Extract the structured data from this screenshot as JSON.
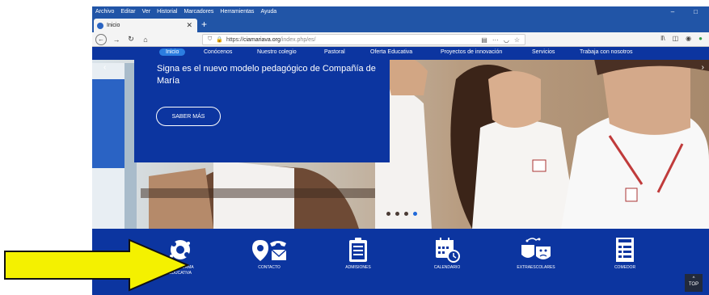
{
  "browser": {
    "menu": [
      "Archivo",
      "Editar",
      "Ver",
      "Historial",
      "Marcadores",
      "Herramientas",
      "Ayuda"
    ],
    "tab_title": "Inicio",
    "url_prefix": "https://",
    "url_host": "ciamariava.org",
    "url_path": "/index.php/es/",
    "window_controls": {
      "minimize": "–",
      "maximize": "□"
    }
  },
  "nav": {
    "items": [
      "Inicio",
      "Conócenos",
      "Nuestro colegio",
      "Pastoral",
      "Oferta Educativa",
      "Proyectos de innovación",
      "Servicios",
      "Trabaja con nosotros"
    ],
    "active": "Inicio"
  },
  "hero": {
    "headline": "Signa es el nuevo modelo pedagógico de Compañía de María",
    "button_label": "SABER MÁS",
    "slide_dots": 4,
    "active_dot": 4
  },
  "quick_links": [
    {
      "label_line1": "PLATAFORMA",
      "label_line2": "EDUCATIVA",
      "icon": "globe-icon"
    },
    {
      "label_line1": "CONTACTO",
      "label_line2": "",
      "icon": "contact-icon"
    },
    {
      "label_line1": "ADMISIONES",
      "label_line2": "",
      "icon": "clipboard-icon"
    },
    {
      "label_line1": "CALENDARIO",
      "label_line2": "",
      "icon": "calendar-icon"
    },
    {
      "label_line1": "EXTRAESCOLARES",
      "label_line2": "",
      "icon": "theater-masks-icon"
    },
    {
      "label_line1": "COMEDOR",
      "label_line2": "",
      "icon": "menu-list-icon"
    }
  ],
  "top_button": {
    "label": "TOP"
  },
  "colors": {
    "brand_blue": "#0c35a0",
    "accent_blue": "#2b7de0",
    "arrow_yellow": "#f4f100"
  }
}
